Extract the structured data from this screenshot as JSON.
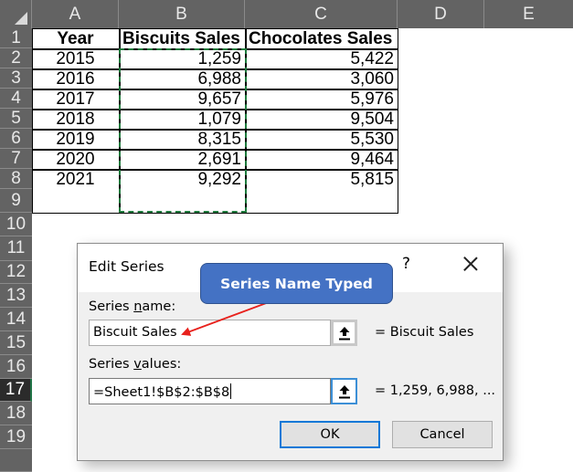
{
  "sheet": {
    "columns": [
      "A",
      "B",
      "C",
      "D",
      "E"
    ],
    "rows": [
      "1",
      "2",
      "3",
      "4",
      "5",
      "6",
      "7",
      "8",
      "9",
      "10",
      "11",
      "12",
      "13",
      "14",
      "15",
      "16",
      "17",
      "18",
      "19"
    ],
    "selected_row": "17",
    "headers": [
      "Year",
      "Biscuits Sales",
      "Chocolates Sales"
    ],
    "data": [
      {
        "year": "2015",
        "biscuits": "1,259",
        "chocolates": "5,422"
      },
      {
        "year": "2016",
        "biscuits": "6,988",
        "chocolates": "3,060"
      },
      {
        "year": "2017",
        "biscuits": "9,657",
        "chocolates": "5,976"
      },
      {
        "year": "2018",
        "biscuits": "1,079",
        "chocolates": "9,504"
      },
      {
        "year": "2019",
        "biscuits": "8,315",
        "chocolates": "5,530"
      },
      {
        "year": "2020",
        "biscuits": "2,691",
        "chocolates": "9,464"
      },
      {
        "year": "2021",
        "biscuits": "9,292",
        "chocolates": "5,815"
      }
    ],
    "copy_range_color": "#1e7b3d"
  },
  "dialog": {
    "title": "Edit Series",
    "help": "?",
    "series_name_label_pre": "Series ",
    "series_name_label_key": "n",
    "series_name_label_post": "ame:",
    "series_name_value": "Biscuit Sales",
    "series_name_preview": "= Biscuit Sales",
    "series_values_label_pre": "Series ",
    "series_values_label_key": "v",
    "series_values_label_post": "alues:",
    "series_values_value": "=Sheet1!$B$2:$B$8",
    "series_values_preview": "= 1,259, 6,988, ...",
    "ok_label": "OK",
    "cancel_label": "Cancel"
  },
  "annotation": {
    "callout_text": "Series Name Typed",
    "callout_color": "#4472c4",
    "arrow_color": "#e8211c"
  }
}
